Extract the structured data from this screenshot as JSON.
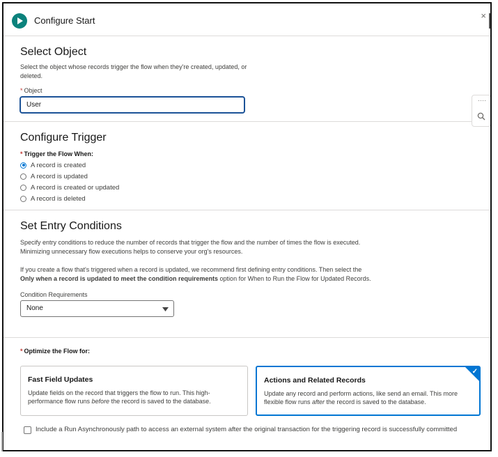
{
  "header": {
    "title": "Configure Start",
    "close_label": "×"
  },
  "select_object": {
    "title": "Select Object",
    "description_line1": "Select the object whose records trigger the flow when they're created, updated, or",
    "description_line2": "deleted.",
    "required_mark": "*",
    "field_label": "Object",
    "field_value": "User"
  },
  "side_tool": {
    "dots": "····",
    "search_icon": "search-icon"
  },
  "configure_trigger": {
    "title": "Configure Trigger",
    "required_mark": "*",
    "label": "Trigger the Flow When:",
    "options": [
      {
        "label": "A record is created",
        "selected": true
      },
      {
        "label": "A record is updated",
        "selected": false
      },
      {
        "label": "A record is created or updated",
        "selected": false
      },
      {
        "label": "A record is deleted",
        "selected": false
      }
    ]
  },
  "entry_conditions": {
    "title": "Set Entry Conditions",
    "para1_line1": "Specify entry conditions to reduce the number of records that trigger the flow and the number of times the flow is executed.",
    "para1_line2": "Minimizing unnecessary flow executions helps to conserve your org's resources.",
    "para2_line1": "If you create a flow that's triggered when a record is updated, we recommend first defining entry conditions. Then select the",
    "para2_bold": "Only when a record is updated to meet the condition requirements",
    "para2_rest": " option for When to Run the Flow for Updated Records.",
    "condition_label": "Condition Requirements",
    "condition_value": "None"
  },
  "optimize": {
    "required_mark": "*",
    "label": "Optimize the Flow for:",
    "cards": [
      {
        "title": "Fast Field Updates",
        "desc_part1": "Update fields on the record that triggers the flow to run. This high-performance flow runs ",
        "desc_em": "before",
        "desc_part2": " the record is saved to the database.",
        "selected": false
      },
      {
        "title": "Actions and Related Records",
        "desc_part1": "Update any record and perform actions, like send an email. This more flexible flow runs ",
        "desc_em": "after",
        "desc_part2": " the record is saved to the database.",
        "selected": true
      }
    ],
    "async_label": "Include a Run Asynchronously path to access an external system after the original transaction for the triggering record is successfully committed",
    "async_checked": false
  },
  "colors": {
    "accent": "#0176d3",
    "start_icon": "#0b827c",
    "required": "#c23934"
  }
}
